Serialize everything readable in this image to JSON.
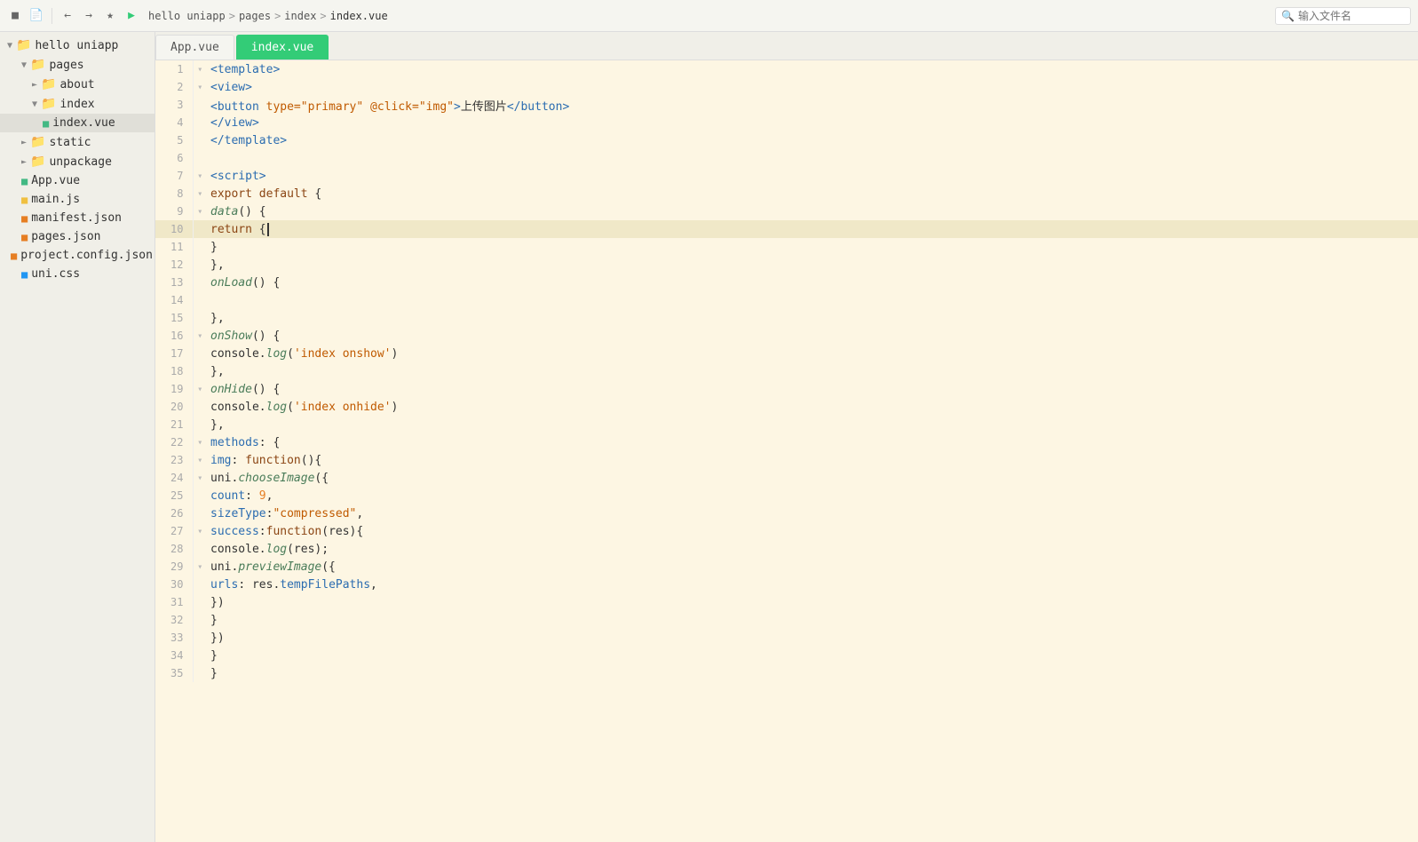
{
  "topbar": {
    "breadcrumb": [
      "hello uniapp",
      "pages",
      "index",
      "index.vue"
    ],
    "search_placeholder": "输入文件名"
  },
  "tabs": [
    {
      "label": "App.vue",
      "active": false
    },
    {
      "label": "index.vue",
      "active": true
    }
  ],
  "sidebar": {
    "root": "hello uniapp",
    "items": [
      {
        "id": "hello-uniapp",
        "label": "hello uniapp",
        "indent": 0,
        "type": "root",
        "expanded": true,
        "icon": "▾"
      },
      {
        "id": "pages",
        "label": "pages",
        "indent": 1,
        "type": "folder",
        "expanded": true,
        "icon": "▾"
      },
      {
        "id": "about",
        "label": "about",
        "indent": 2,
        "type": "folder",
        "expanded": false,
        "icon": "▸"
      },
      {
        "id": "index",
        "label": "index",
        "indent": 2,
        "type": "folder",
        "expanded": true,
        "icon": "▾"
      },
      {
        "id": "index-vue",
        "label": "index.vue",
        "indent": 3,
        "type": "file-vue",
        "active": true
      },
      {
        "id": "static",
        "label": "static",
        "indent": 1,
        "type": "folder",
        "expanded": false,
        "icon": "▸"
      },
      {
        "id": "unpackage",
        "label": "unpackage",
        "indent": 1,
        "type": "folder",
        "expanded": false,
        "icon": "▸"
      },
      {
        "id": "app-vue",
        "label": "App.vue",
        "indent": 1,
        "type": "file-vue"
      },
      {
        "id": "main-js",
        "label": "main.js",
        "indent": 1,
        "type": "file-js"
      },
      {
        "id": "manifest-json",
        "label": "manifest.json",
        "indent": 1,
        "type": "file-json"
      },
      {
        "id": "pages-json",
        "label": "pages.json",
        "indent": 1,
        "type": "file-json"
      },
      {
        "id": "project-config",
        "label": "project.config.json",
        "indent": 1,
        "type": "file-json"
      },
      {
        "id": "uni-css",
        "label": "uni.css",
        "indent": 1,
        "type": "file-css"
      }
    ]
  },
  "code": {
    "lines": [
      {
        "num": 1,
        "fold": "▾",
        "content": "<template>",
        "tokens": [
          {
            "t": "tag",
            "v": "<template>"
          }
        ]
      },
      {
        "num": 2,
        "fold": "▾",
        "content": "    <view>",
        "indent": "    ",
        "tokens": [
          {
            "t": "tag",
            "v": "<view>"
          }
        ]
      },
      {
        "num": 3,
        "fold": "",
        "content": "        <button type=\"primary\" @click=\"img\">上传图片</button>",
        "indent": "        ",
        "tokens": [
          {
            "t": "tag",
            "v": "<button"
          },
          {
            "t": "plain",
            "v": " "
          },
          {
            "t": "attr",
            "v": "type="
          },
          {
            "t": "str",
            "v": "\"primary\""
          },
          {
            "t": "plain",
            "v": " "
          },
          {
            "t": "attr",
            "v": "@click="
          },
          {
            "t": "str",
            "v": "\"img\""
          },
          {
            "t": "tag",
            "v": ">"
          },
          {
            "t": "plain",
            "v": "上传图片"
          },
          {
            "t": "tag",
            "v": "</button>"
          }
        ]
      },
      {
        "num": 4,
        "fold": "",
        "content": "    </view>",
        "indent": "    ",
        "tokens": [
          {
            "t": "tag",
            "v": "</view>"
          }
        ]
      },
      {
        "num": 5,
        "fold": "",
        "content": "</template>",
        "tokens": [
          {
            "t": "tag",
            "v": "</template>"
          }
        ]
      },
      {
        "num": 6,
        "fold": "",
        "content": ""
      },
      {
        "num": 7,
        "fold": "▾",
        "content": "<script>",
        "tokens": [
          {
            "t": "tag",
            "v": "<script>"
          }
        ]
      },
      {
        "num": 8,
        "fold": "▾",
        "content": "    export default {",
        "indent": "    ",
        "tokens": [
          {
            "t": "kw",
            "v": "export"
          },
          {
            "t": "plain",
            "v": " "
          },
          {
            "t": "kw",
            "v": "default"
          },
          {
            "t": "plain",
            "v": " {"
          }
        ]
      },
      {
        "num": 9,
        "fold": "▾",
        "content": "        data() {",
        "indent": "        ",
        "tokens": [
          {
            "t": "fn",
            "v": "data"
          },
          {
            "t": "plain",
            "v": "() {"
          }
        ]
      },
      {
        "num": 10,
        "fold": "",
        "content": "            return {",
        "indent": "            ",
        "tokens": [
          {
            "t": "kw",
            "v": "return"
          },
          {
            "t": "plain",
            "v": " {"
          }
        ],
        "highlighted": true
      },
      {
        "num": 11,
        "fold": "",
        "content": "            }",
        "indent": "            ",
        "tokens": [
          {
            "t": "plain",
            "v": "}"
          }
        ]
      },
      {
        "num": 12,
        "fold": "",
        "content": "        },",
        "indent": "        ",
        "tokens": [
          {
            "t": "plain",
            "v": "},"
          }
        ]
      },
      {
        "num": 13,
        "fold": "",
        "content": "        onLoad() {",
        "indent": "        ",
        "tokens": [
          {
            "t": "fn",
            "v": "onLoad"
          },
          {
            "t": "plain",
            "v": "() {"
          }
        ]
      },
      {
        "num": 14,
        "fold": "",
        "content": ""
      },
      {
        "num": 15,
        "fold": "",
        "content": "        },",
        "indent": "        ",
        "tokens": [
          {
            "t": "plain",
            "v": "},"
          }
        ]
      },
      {
        "num": 16,
        "fold": "▾",
        "content": "        onShow() {",
        "indent": "        ",
        "tokens": [
          {
            "t": "fn",
            "v": "onShow"
          },
          {
            "t": "plain",
            "v": "() {"
          }
        ]
      },
      {
        "num": 17,
        "fold": "",
        "content": "            console.log('index onshow')",
        "indent": "            ",
        "tokens": [
          {
            "t": "plain",
            "v": "console."
          },
          {
            "t": "fn",
            "v": "log"
          },
          {
            "t": "plain",
            "v": "("
          },
          {
            "t": "str",
            "v": "'index onshow'"
          },
          {
            "t": "plain",
            "v": ")"
          }
        ]
      },
      {
        "num": 18,
        "fold": "",
        "content": "        },",
        "indent": "        ",
        "tokens": [
          {
            "t": "plain",
            "v": "},"
          }
        ]
      },
      {
        "num": 19,
        "fold": "▾",
        "content": "        onHide() {",
        "indent": "        ",
        "tokens": [
          {
            "t": "fn",
            "v": "onHide"
          },
          {
            "t": "plain",
            "v": "() {"
          }
        ]
      },
      {
        "num": 20,
        "fold": "",
        "content": "            console.log('index onhide')",
        "indent": "            ",
        "tokens": [
          {
            "t": "plain",
            "v": "console."
          },
          {
            "t": "fn",
            "v": "log"
          },
          {
            "t": "plain",
            "v": "("
          },
          {
            "t": "str",
            "v": "'index onhide'"
          },
          {
            "t": "plain",
            "v": ")"
          }
        ]
      },
      {
        "num": 21,
        "fold": "",
        "content": "        },",
        "indent": "        ",
        "tokens": [
          {
            "t": "plain",
            "v": "},"
          }
        ]
      },
      {
        "num": 22,
        "fold": "▾",
        "content": "        methods: {",
        "indent": "        ",
        "tokens": [
          {
            "t": "prop",
            "v": "methods"
          },
          {
            "t": "plain",
            "v": ": {"
          }
        ]
      },
      {
        "num": 23,
        "fold": "▾",
        "content": "            img: function(){",
        "indent": "            ",
        "tokens": [
          {
            "t": "prop",
            "v": "img"
          },
          {
            "t": "plain",
            "v": ": "
          },
          {
            "t": "kw",
            "v": "function"
          },
          {
            "t": "plain",
            "v": "(){"
          }
        ]
      },
      {
        "num": 24,
        "fold": "▾",
        "content": "                uni.chooseImage({",
        "indent": "                ",
        "tokens": [
          {
            "t": "plain",
            "v": "uni."
          },
          {
            "t": "fn",
            "v": "chooseImage"
          },
          {
            "t": "plain",
            "v": "({"
          }
        ]
      },
      {
        "num": 25,
        "fold": "",
        "content": "                    count: 9,",
        "indent": "                    ",
        "tokens": [
          {
            "t": "prop",
            "v": "count"
          },
          {
            "t": "plain",
            "v": ": "
          },
          {
            "t": "num",
            "v": "9"
          },
          {
            "t": "plain",
            "v": ","
          }
        ]
      },
      {
        "num": 26,
        "fold": "",
        "content": "                    sizeType:\"compressed\",",
        "indent": "                    ",
        "tokens": [
          {
            "t": "prop",
            "v": "sizeType"
          },
          {
            "t": "plain",
            "v": ":"
          },
          {
            "t": "str",
            "v": "\"compressed\""
          },
          {
            "t": "plain",
            "v": ","
          }
        ]
      },
      {
        "num": 27,
        "fold": "▾",
        "content": "                    success:function(res){",
        "indent": "                    ",
        "tokens": [
          {
            "t": "prop",
            "v": "success"
          },
          {
            "t": "plain",
            "v": ":"
          },
          {
            "t": "kw",
            "v": "function"
          },
          {
            "t": "plain",
            "v": "(res){"
          }
        ]
      },
      {
        "num": 28,
        "fold": "",
        "content": "                        console.log(res);",
        "indent": "                        ",
        "tokens": [
          {
            "t": "plain",
            "v": "console."
          },
          {
            "t": "fn",
            "v": "log"
          },
          {
            "t": "plain",
            "v": "(res);"
          }
        ]
      },
      {
        "num": 29,
        "fold": "▾",
        "content": "                        uni.previewImage({",
        "indent": "                        ",
        "tokens": [
          {
            "t": "plain",
            "v": "uni."
          },
          {
            "t": "fn",
            "v": "previewImage"
          },
          {
            "t": "plain",
            "v": "({"
          }
        ]
      },
      {
        "num": 30,
        "fold": "",
        "content": "                            urls: res.tempFilePaths,",
        "indent": "                            ",
        "tokens": [
          {
            "t": "prop",
            "v": "urls"
          },
          {
            "t": "plain",
            "v": ": res."
          },
          {
            "t": "prop",
            "v": "tempFilePaths"
          },
          {
            "t": "plain",
            "v": ","
          }
        ]
      },
      {
        "num": 31,
        "fold": "",
        "content": "                        })",
        "indent": "                        ",
        "tokens": [
          {
            "t": "plain",
            "v": "})"
          }
        ]
      },
      {
        "num": 32,
        "fold": "",
        "content": "                    }",
        "indent": "                    ",
        "tokens": [
          {
            "t": "plain",
            "v": "}"
          }
        ]
      },
      {
        "num": 33,
        "fold": "",
        "content": "                })",
        "indent": "                ",
        "tokens": [
          {
            "t": "plain",
            "v": "})"
          }
        ]
      },
      {
        "num": 34,
        "fold": "",
        "content": "            }",
        "indent": "            ",
        "tokens": [
          {
            "t": "plain",
            "v": "}"
          }
        ]
      },
      {
        "num": 35,
        "fold": "",
        "content": "        }",
        "indent": "        ",
        "tokens": [
          {
            "t": "plain",
            "v": "}"
          }
        ]
      }
    ]
  }
}
